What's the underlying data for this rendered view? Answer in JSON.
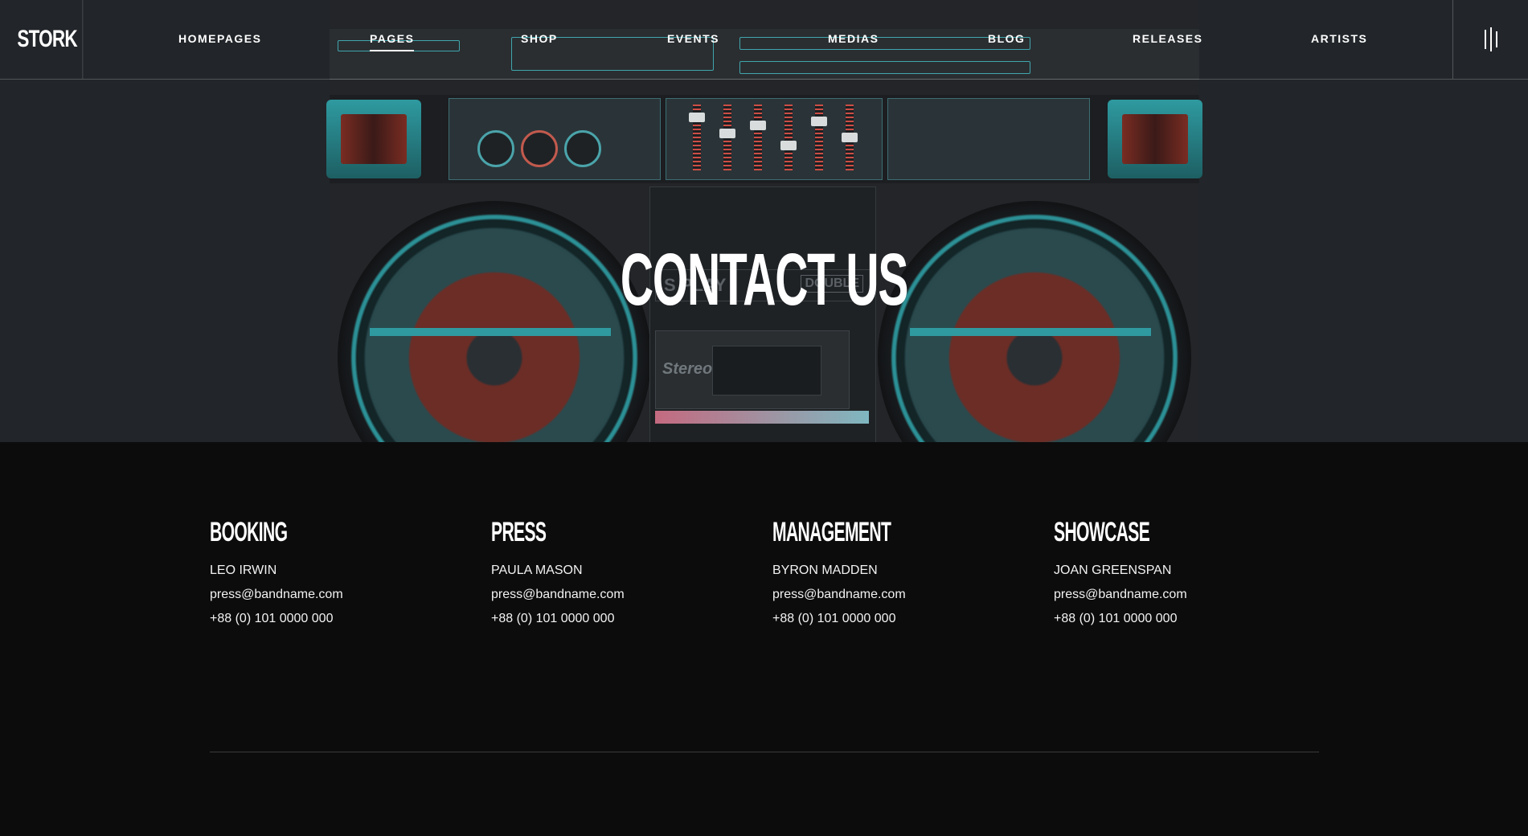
{
  "header": {
    "logo": "STORK",
    "nav": [
      {
        "label": "HOMEPAGES",
        "active": false
      },
      {
        "label": "PAGES",
        "active": true
      },
      {
        "label": "SHOP",
        "active": false
      },
      {
        "label": "EVENTS",
        "active": false
      },
      {
        "label": "MEDIAS",
        "active": false
      },
      {
        "label": "BLOG",
        "active": false
      },
      {
        "label": "RELEASES",
        "active": false
      },
      {
        "label": "ARTISTS",
        "active": false
      }
    ],
    "menu_icon": "menu-bars-icon"
  },
  "hero": {
    "title": "CONTACT US",
    "deck_text_1": "S PLAY",
    "deck_text_2": "DOUBLE",
    "deck_text_3": "Stereo"
  },
  "contacts": [
    {
      "heading": "BOOKING",
      "name": "LEO IRWIN",
      "email": "press@bandname.com",
      "phone": "+88 (0) 101 0000 000"
    },
    {
      "heading": "PRESS",
      "name": "PAULA MASON",
      "email": "press@bandname.com",
      "phone": "+88 (0) 101 0000 000"
    },
    {
      "heading": "MANAGEMENT",
      "name": "BYRON MADDEN",
      "email": "press@bandname.com",
      "phone": "+88 (0) 101 0000 000"
    },
    {
      "heading": "SHOWCASE",
      "name": "JOAN GREENSPAN",
      "email": "press@bandname.com",
      "phone": "+88 (0) 101 0000 000"
    }
  ],
  "colors": {
    "background": "#0c0c0d",
    "hero_bg": "#22262a",
    "accent_teal": "#2f9aa0",
    "accent_red": "#c25a4e"
  }
}
